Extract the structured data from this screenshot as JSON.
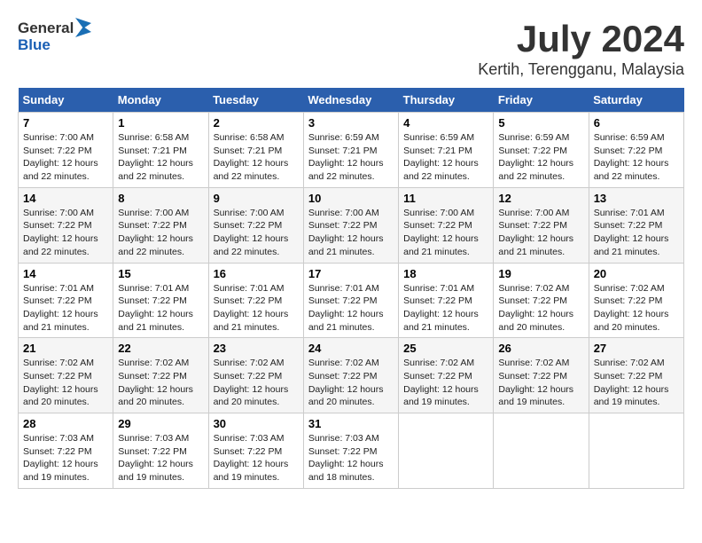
{
  "header": {
    "logo_general": "General",
    "logo_blue": "Blue",
    "title": "July 2024",
    "subtitle": "Kertih, Terengganu, Malaysia"
  },
  "days_of_week": [
    "Sunday",
    "Monday",
    "Tuesday",
    "Wednesday",
    "Thursday",
    "Friday",
    "Saturday"
  ],
  "weeks": [
    [
      {
        "day": "",
        "info": ""
      },
      {
        "day": "1",
        "info": "Sunrise: 6:58 AM\nSunset: 7:21 PM\nDaylight: 12 hours\nand 22 minutes."
      },
      {
        "day": "2",
        "info": "Sunrise: 6:58 AM\nSunset: 7:21 PM\nDaylight: 12 hours\nand 22 minutes."
      },
      {
        "day": "3",
        "info": "Sunrise: 6:59 AM\nSunset: 7:21 PM\nDaylight: 12 hours\nand 22 minutes."
      },
      {
        "day": "4",
        "info": "Sunrise: 6:59 AM\nSunset: 7:21 PM\nDaylight: 12 hours\nand 22 minutes."
      },
      {
        "day": "5",
        "info": "Sunrise: 6:59 AM\nSunset: 7:22 PM\nDaylight: 12 hours\nand 22 minutes."
      },
      {
        "day": "6",
        "info": "Sunrise: 6:59 AM\nSunset: 7:22 PM\nDaylight: 12 hours\nand 22 minutes."
      }
    ],
    [
      {
        "day": "7",
        "info": ""
      },
      {
        "day": "8",
        "info": "Sunrise: 7:00 AM\nSunset: 7:22 PM\nDaylight: 12 hours\nand 22 minutes."
      },
      {
        "day": "9",
        "info": "Sunrise: 7:00 AM\nSunset: 7:22 PM\nDaylight: 12 hours\nand 22 minutes."
      },
      {
        "day": "10",
        "info": "Sunrise: 7:00 AM\nSunset: 7:22 PM\nDaylight: 12 hours\nand 21 minutes."
      },
      {
        "day": "11",
        "info": "Sunrise: 7:00 AM\nSunset: 7:22 PM\nDaylight: 12 hours\nand 21 minutes."
      },
      {
        "day": "12",
        "info": "Sunrise: 7:00 AM\nSunset: 7:22 PM\nDaylight: 12 hours\nand 21 minutes."
      },
      {
        "day": "13",
        "info": "Sunrise: 7:01 AM\nSunset: 7:22 PM\nDaylight: 12 hours\nand 21 minutes."
      }
    ],
    [
      {
        "day": "14",
        "info": ""
      },
      {
        "day": "15",
        "info": "Sunrise: 7:01 AM\nSunset: 7:22 PM\nDaylight: 12 hours\nand 21 minutes."
      },
      {
        "day": "16",
        "info": "Sunrise: 7:01 AM\nSunset: 7:22 PM\nDaylight: 12 hours\nand 21 minutes."
      },
      {
        "day": "17",
        "info": "Sunrise: 7:01 AM\nSunset: 7:22 PM\nDaylight: 12 hours\nand 21 minutes."
      },
      {
        "day": "18",
        "info": "Sunrise: 7:01 AM\nSunset: 7:22 PM\nDaylight: 12 hours\nand 21 minutes."
      },
      {
        "day": "19",
        "info": "Sunrise: 7:02 AM\nSunset: 7:22 PM\nDaylight: 12 hours\nand 20 minutes."
      },
      {
        "day": "20",
        "info": "Sunrise: 7:02 AM\nSunset: 7:22 PM\nDaylight: 12 hours\nand 20 minutes."
      }
    ],
    [
      {
        "day": "21",
        "info": ""
      },
      {
        "day": "22",
        "info": "Sunrise: 7:02 AM\nSunset: 7:22 PM\nDaylight: 12 hours\nand 20 minutes."
      },
      {
        "day": "23",
        "info": "Sunrise: 7:02 AM\nSunset: 7:22 PM\nDaylight: 12 hours\nand 20 minutes."
      },
      {
        "day": "24",
        "info": "Sunrise: 7:02 AM\nSunset: 7:22 PM\nDaylight: 12 hours\nand 20 minutes."
      },
      {
        "day": "25",
        "info": "Sunrise: 7:02 AM\nSunset: 7:22 PM\nDaylight: 12 hours\nand 19 minutes."
      },
      {
        "day": "26",
        "info": "Sunrise: 7:02 AM\nSunset: 7:22 PM\nDaylight: 12 hours\nand 19 minutes."
      },
      {
        "day": "27",
        "info": "Sunrise: 7:02 AM\nSunset: 7:22 PM\nDaylight: 12 hours\nand 19 minutes."
      }
    ],
    [
      {
        "day": "28",
        "info": "Sunrise: 7:03 AM\nSunset: 7:22 PM\nDaylight: 12 hours\nand 19 minutes."
      },
      {
        "day": "29",
        "info": "Sunrise: 7:03 AM\nSunset: 7:22 PM\nDaylight: 12 hours\nand 19 minutes."
      },
      {
        "day": "30",
        "info": "Sunrise: 7:03 AM\nSunset: 7:22 PM\nDaylight: 12 hours\nand 19 minutes."
      },
      {
        "day": "31",
        "info": "Sunrise: 7:03 AM\nSunset: 7:22 PM\nDaylight: 12 hours\nand 18 minutes."
      },
      {
        "day": "",
        "info": ""
      },
      {
        "day": "",
        "info": ""
      },
      {
        "day": "",
        "info": ""
      }
    ]
  ],
  "week1_day7_info": "Sunrise: 7:00 AM\nSunset: 7:22 PM\nDaylight: 12 hours\nand 22 minutes.",
  "week2_day14_info": "Sunrise: 7:01 AM\nSunset: 7:22 PM\nDaylight: 12 hours\nand 21 minutes.",
  "week3_day21_info": "Sunrise: 7:02 AM\nSunset: 7:22 PM\nDaylight: 12 hours\nand 20 minutes."
}
